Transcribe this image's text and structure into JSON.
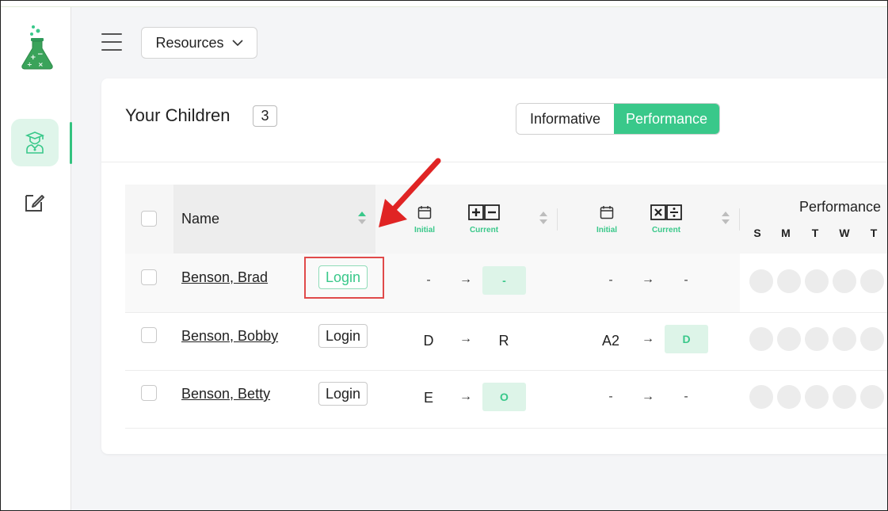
{
  "header": {
    "resources_label": "Resources"
  },
  "sidebar": {
    "items": [
      {
        "icon": "student-icon",
        "active": true
      },
      {
        "icon": "edit-icon",
        "active": false
      }
    ]
  },
  "card": {
    "title": "Your Children",
    "count": "3",
    "view_options": [
      "Informative",
      "Performance"
    ],
    "active_view": "Performance"
  },
  "table": {
    "name_header": "Name",
    "group1": {
      "initial_label": "Initial",
      "current_label": "Current",
      "icon": "add-subtract-icon"
    },
    "group2": {
      "initial_label": "Initial",
      "current_label": "Current",
      "icon": "multiply-divide-icon"
    },
    "performance_header": "Performance",
    "days": [
      "S",
      "M",
      "T",
      "W",
      "T"
    ],
    "rows": [
      {
        "name": "Benson, Brad",
        "login": "Login",
        "g1_initial": "-",
        "g1_current": "-",
        "g2_initial": "-",
        "g2_current": "-"
      },
      {
        "name": "Benson, Bobby",
        "login": "Login",
        "g1_initial": "D",
        "g1_current": "R",
        "g2_initial": "A2",
        "g2_current": "D"
      },
      {
        "name": "Benson, Betty",
        "login": "Login",
        "g1_initial": "E",
        "g1_current": "O",
        "g2_initial": "-",
        "g2_current": "-"
      }
    ],
    "arrow_glyph": "→"
  },
  "colors": {
    "accent": "#39c88a",
    "accent_light": "#ddf4e8",
    "annotation_red": "#e04a4a"
  }
}
